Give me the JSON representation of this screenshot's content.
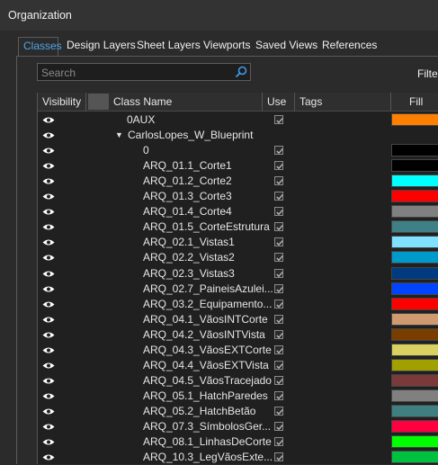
{
  "window": {
    "title": "Organization"
  },
  "tabs": [
    {
      "label": "Classes",
      "active": true
    },
    {
      "label": "Design Layers"
    },
    {
      "label": "Sheet Layers"
    },
    {
      "label": "Viewports"
    },
    {
      "label": "Saved Views"
    },
    {
      "label": "References"
    }
  ],
  "search": {
    "placeholder": "Search"
  },
  "filter_label": "Filter",
  "columns": {
    "visibility": "Visibility",
    "name": "Class Name",
    "use": "Use",
    "tags": "Tags",
    "fill": "Fill"
  },
  "rows": [
    {
      "name": "0AUX",
      "level": 0,
      "fill": "#ff8000"
    },
    {
      "name": "CarlosLopes_W_Blueprint",
      "level": 0,
      "group": true,
      "fill": ""
    },
    {
      "name": "0",
      "level": 1,
      "fill": "#000000"
    },
    {
      "name": "ARQ_01.1_Corte1",
      "level": 1,
      "fill": "#000000"
    },
    {
      "name": "ARQ_01.2_Corte2",
      "level": 1,
      "fill": "#00ffff"
    },
    {
      "name": "ARQ_01.3_Corte3",
      "level": 1,
      "fill": "#ff0000"
    },
    {
      "name": "ARQ_01.4_Corte4",
      "level": 1,
      "fill": "#808080"
    },
    {
      "name": "ARQ_01.5_CorteEstrutura",
      "level": 1,
      "fill": "#3f7f86"
    },
    {
      "name": "ARQ_02.1_Vistas1",
      "level": 1,
      "fill": "#80e0ff"
    },
    {
      "name": "ARQ_02.2_Vistas2",
      "level": 1,
      "fill": "#0099cc"
    },
    {
      "name": "ARQ_02.3_Vistas3",
      "level": 1,
      "fill": "#003a80"
    },
    {
      "name": "ARQ_02.7_PaineisAzulei...",
      "level": 1,
      "fill": "#0044ff"
    },
    {
      "name": "ARQ_03.2_Equipamento...",
      "level": 1,
      "fill": "#ff0000"
    },
    {
      "name": "ARQ_04.1_VãosINTCorte",
      "level": 1,
      "fill": "#d09a70"
    },
    {
      "name": "ARQ_04.2_VãosINTVista",
      "level": 1,
      "fill": "#7a3d00"
    },
    {
      "name": "ARQ_04.3_VãosEXTCorte",
      "level": 1,
      "fill": "#d8d060"
    },
    {
      "name": "ARQ_04.4_VãosEXTVista",
      "level": 1,
      "fill": "#a0a000"
    },
    {
      "name": "ARQ_04.5_VãosTracejado",
      "level": 1,
      "fill": "#7a3a3a"
    },
    {
      "name": "ARQ_05.1_HatchParedes",
      "level": 1,
      "fill": "#808080"
    },
    {
      "name": "ARQ_05.2_HatchBetão",
      "level": 1,
      "fill": "#3f7f7f"
    },
    {
      "name": "ARQ_07.3_SímbolosGer...",
      "level": 1,
      "fill": "#ff0040"
    },
    {
      "name": "ARQ_08.1_LinhasDeCorte",
      "level": 1,
      "fill": "#00ff00"
    },
    {
      "name": "ARQ_10.3_LegVãosExte...",
      "level": 1,
      "fill": "#00c040"
    }
  ]
}
